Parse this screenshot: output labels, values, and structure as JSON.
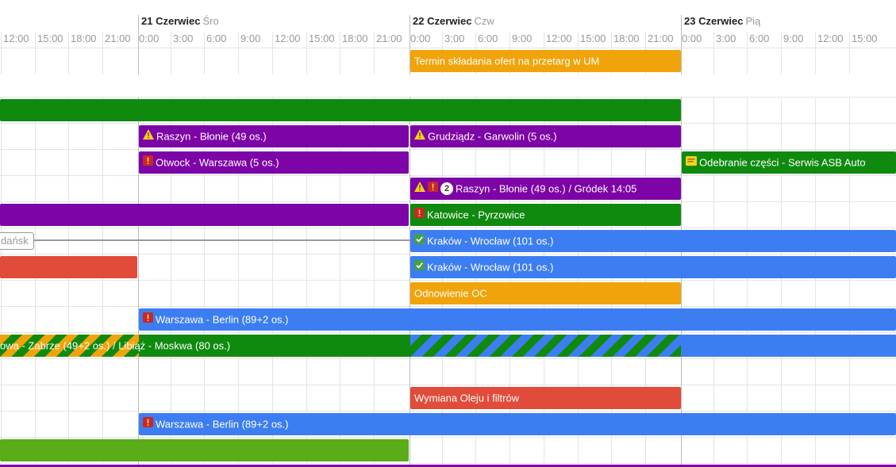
{
  "days": [
    {
      "date": "21 Czerwiec",
      "dow": "Śro"
    },
    {
      "date": "22 Czerwiec",
      "dow": "Czw"
    },
    {
      "date": "23 Czerwiec",
      "dow": "Pią"
    }
  ],
  "hour_labels": [
    "12:00",
    "15:00",
    "18:00",
    "21:00",
    "0:00",
    "3:00",
    "6:00",
    "9:00",
    "12:00",
    "15:00",
    "18:00",
    "21:00",
    "0:00",
    "3:00",
    "6:00",
    "9:00",
    "12:00",
    "15:00",
    "18:00",
    "21:00",
    "0:00",
    "3:00",
    "6:00",
    "9:00",
    "12:00",
    "15:00"
  ],
  "connector_tag": "dańsk",
  "events": {
    "tender_deadline": {
      "label": "Termin składania ofert na przetarg w UM",
      "color": "#f0a30a"
    },
    "green_bar_row2": {
      "label": "",
      "color": "#0f8a0f"
    },
    "raszyn_blonie_1": {
      "label": "Raszyn - Błonie (49 os.)",
      "icons": [
        "warning-icon"
      ],
      "color": "#7d04a6"
    },
    "grudziadz_garwolin": {
      "label": "Grudziądz - Garwolin (5 os.)",
      "icons": [
        "warning-icon"
      ],
      "color": "#7d04a6"
    },
    "otwock_warszawa": {
      "label": "Otwock - Warszawa (5 os.)",
      "icons": [
        "alert-icon"
      ],
      "color": "#7d04a6"
    },
    "odebranie_czesci": {
      "label": "Odebranie części - Serwis ASB Auto",
      "icons": [
        "note-icon"
      ],
      "color": "#0f8a0f"
    },
    "raszyn_blonie_grodek": {
      "label": "Raszyn - Błonie (49 os.) / Gródek 14:05",
      "badge": "2",
      "icons": [
        "warning-icon",
        "alert-icon"
      ],
      "color": "#7d04a6"
    },
    "purple_bar_row5": {
      "label": "",
      "color": "#7d04a6"
    },
    "katowice_pyrzowice": {
      "label": "Katowice - Pyrzowice",
      "icons": [
        "alert-icon"
      ],
      "color": "#0f8a0f"
    },
    "krakow_wroclaw_1": {
      "label": "Kraków - Wrocław (101 os.)",
      "icons": [
        "check-icon"
      ],
      "color": "#3c7ef2"
    },
    "red_bar_row7": {
      "label": "",
      "color": "#e04b3a"
    },
    "krakow_wroclaw_2": {
      "label": "Kraków - Wrocław (101 os.)",
      "icons": [
        "check-icon"
      ],
      "color": "#3c7ef2"
    },
    "odnowienie_oc": {
      "label": "Odnowienie OC",
      "color": "#f0a30a"
    },
    "warszawa_berlin_1": {
      "label": "Warszawa - Berlin (89+2 os.)",
      "icons": [
        "alert-icon"
      ],
      "color": "#3c7ef2"
    },
    "zabrze_moskwa": {
      "label": "owa - Zabrze (49+2 os.) / Libiąż - Moskwa (80 os.)",
      "color": "#0f8a0f"
    },
    "wymiana_oleju": {
      "label": "Wymiana Oleju i filtrów",
      "color": "#e04b3a"
    },
    "warszawa_berlin_2": {
      "label": "Warszawa - Berlin (89+2 os.)",
      "icons": [
        "alert-icon"
      ],
      "color": "#3c7ef2"
    },
    "lime_bar_row14": {
      "label": "",
      "color": "#5aac19"
    }
  }
}
